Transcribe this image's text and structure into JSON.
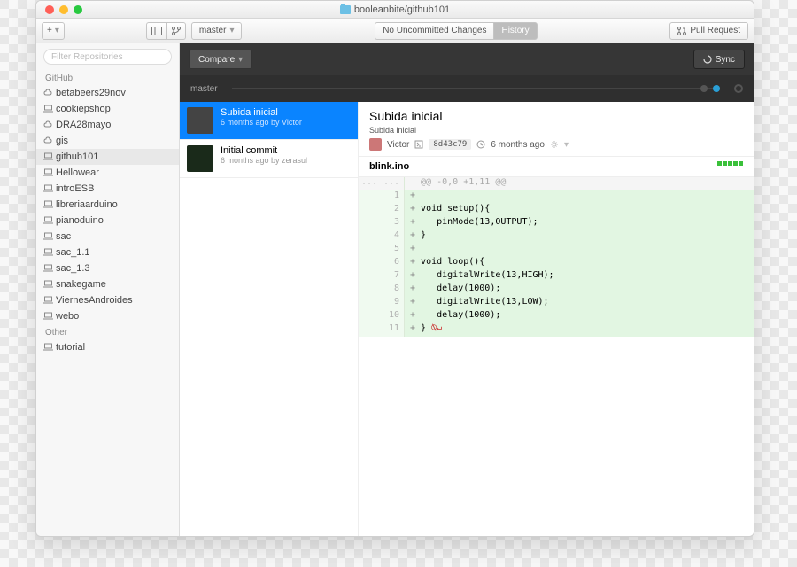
{
  "title": "booleanbite/github101",
  "toolbar": {
    "add": "+",
    "branch_label": "master",
    "changes_label": "No Uncommitted Changes",
    "history_label": "History",
    "pull_request_label": "Pull Request"
  },
  "sidebar": {
    "filter_placeholder": "Filter Repositories",
    "groups": [
      {
        "name": "GitHub",
        "items": [
          {
            "icon": "cloud",
            "label": "betabeers29nov"
          },
          {
            "icon": "laptop",
            "label": "cookiepshop"
          },
          {
            "icon": "cloud",
            "label": "DRA28mayo"
          },
          {
            "icon": "cloud",
            "label": "gis"
          },
          {
            "icon": "laptop",
            "label": "github101",
            "selected": true
          },
          {
            "icon": "laptop",
            "label": "Hellowear"
          },
          {
            "icon": "laptop",
            "label": "introESB"
          },
          {
            "icon": "laptop",
            "label": "libreriaarduino"
          },
          {
            "icon": "laptop",
            "label": "pianoduino"
          },
          {
            "icon": "laptop",
            "label": "sac"
          },
          {
            "icon": "laptop",
            "label": "sac_1.1"
          },
          {
            "icon": "laptop",
            "label": "sac_1.3"
          },
          {
            "icon": "laptop",
            "label": "snakegame"
          },
          {
            "icon": "laptop",
            "label": "ViernesAndroides"
          },
          {
            "icon": "laptop",
            "label": "webo"
          }
        ]
      },
      {
        "name": "Other",
        "items": [
          {
            "icon": "laptop",
            "label": "tutorial"
          }
        ]
      }
    ]
  },
  "compare_label": "Compare",
  "sync_label": "Sync",
  "branch_indicator": "master",
  "commits": [
    {
      "title": "Subida inicial",
      "meta": "6 months ago by Victor",
      "selected": true
    },
    {
      "title": "Initial commit",
      "meta": "6 months ago by zerasul"
    }
  ],
  "detail": {
    "title": "Subida inicial",
    "subtitle": "Subida inicial",
    "author": "Victor",
    "sha": "8d43c79",
    "time": "6 months ago",
    "file": "blink.ino"
  },
  "diff": {
    "hunk": "@@ -0,0 +1,11 @@",
    "lines": [
      {
        "n": 1,
        "text": ""
      },
      {
        "n": 2,
        "text": "void setup(){"
      },
      {
        "n": 3,
        "text": "   pinMode(13,OUTPUT);"
      },
      {
        "n": 4,
        "text": "}"
      },
      {
        "n": 5,
        "text": ""
      },
      {
        "n": 6,
        "text": "void loop(){"
      },
      {
        "n": 7,
        "text": "   digitalWrite(13,HIGH);"
      },
      {
        "n": 8,
        "text": "   delay(1000);"
      },
      {
        "n": 9,
        "text": "   digitalWrite(13,LOW);"
      },
      {
        "n": 10,
        "text": "   delay(1000);"
      },
      {
        "n": 11,
        "text": "}",
        "nonewline": true
      }
    ]
  }
}
